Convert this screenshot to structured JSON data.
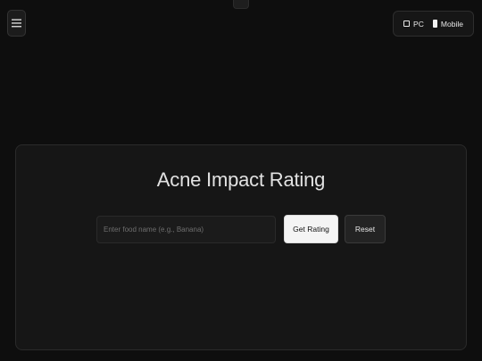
{
  "header": {
    "menu_icon": "hamburger-menu-icon",
    "device_toggle": {
      "options": [
        {
          "label": "PC",
          "icon": "desktop-icon"
        },
        {
          "label": "Mobile",
          "icon": "mobile-icon"
        }
      ]
    }
  },
  "card": {
    "title": "Acne Impact Rating",
    "input": {
      "value": "",
      "placeholder": "Enter food name (e.g., Banana)"
    },
    "buttons": {
      "get_rating": "Get Rating",
      "reset": "Reset"
    }
  },
  "colors": {
    "background": "#0e0e0e",
    "card": "#161616",
    "primary_button": "#f4f4f4",
    "secondary_button": "#232323"
  }
}
